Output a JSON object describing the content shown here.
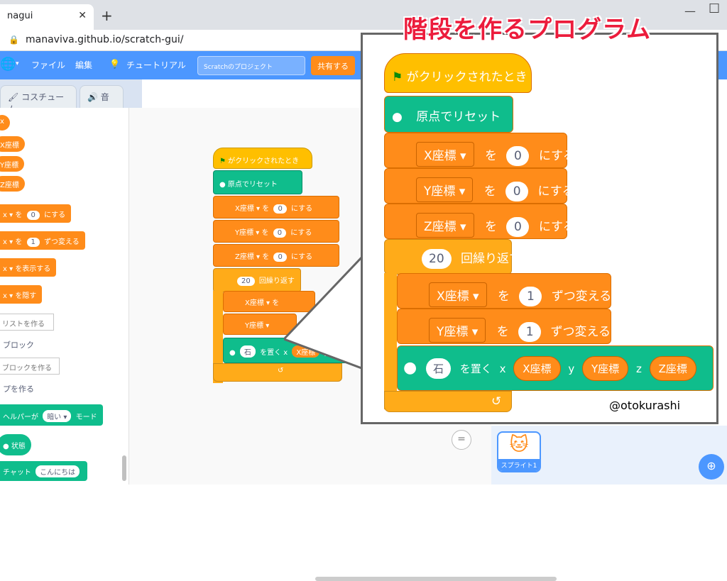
{
  "browser": {
    "tab_title": "nagui",
    "tab_close": "✕",
    "new_tab": "+",
    "minimize": "—",
    "maximize": "☐",
    "url": "manaviva.github.io/scratch-gui/"
  },
  "menubar": {
    "globe": "🌐",
    "globe_caret": "▾",
    "file": "ファイル",
    "edit": "編集",
    "tutorial_icon": "💡",
    "tutorial": "チュートリアル",
    "project_title": "Scratchのプロジェクト",
    "share": "共有する"
  },
  "tabs": {
    "costume": "コスチューム",
    "sound": "音"
  },
  "palette": {
    "reporters": [
      "x",
      "X座標",
      "Y座標",
      "Z座標"
    ],
    "set_block": {
      "var": "x ▾",
      "to": "を",
      "value": "0",
      "suffix": "にする"
    },
    "change_block": {
      "var": "x ▾",
      "to": "を",
      "value": "1",
      "suffix": "ずつ変える"
    },
    "show_block": {
      "var": "x ▾",
      "suffix": "を表示する"
    },
    "hide_block": {
      "var": "x ▾",
      "suffix": "を隠す"
    },
    "make_list": "リストを作る",
    "my_blocks": "ブロック",
    "make_block": "ブロックを作る",
    "section3": "プを作る",
    "helper_block": {
      "prefix": "ヘルパーが",
      "value": "暗い ▾",
      "suffix": "モード"
    },
    "state_block": "状態",
    "chat_block": {
      "prefix": "チャット",
      "value": "こんにちは"
    }
  },
  "code": {
    "hat": "がクリックされたとき",
    "reset": "原点でリセット",
    "set_x": {
      "var": "X座標 ▾",
      "to": "を",
      "value": "0",
      "suffix": "にする"
    },
    "set_y": {
      "var": "Y座標 ▾",
      "to": "を",
      "value": "0",
      "suffix": "にする"
    },
    "set_z": {
      "var": "Z座標 ▾",
      "to": "を",
      "value": "0",
      "suffix": "にする"
    },
    "repeat": {
      "value": "20",
      "label": "回繰り返す"
    },
    "change_x": {
      "var": "X座標 ▾",
      "to": "を",
      "value": "1",
      "suffix": "ずつ変える"
    },
    "change_y": {
      "var": "Y座標 ▾",
      "to": "を",
      "value": "1",
      "suffix": "ずつ変える"
    },
    "place": {
      "item": "石",
      "label": "を置く",
      "x_label": "x",
      "x": "X座標",
      "y_label": "y",
      "y": "Y座標",
      "z_label": "z",
      "z": "Z座標"
    },
    "loop_arrow": "↺"
  },
  "callout": {
    "title": "階段を作るプログラム",
    "credit": "@otokurashi"
  },
  "stage": {
    "zoom_reset": "=",
    "sprite_name": "スプライト1",
    "sprite_icon": "cat-icon",
    "extension_icon": "extension-icon"
  },
  "colors": {
    "motion_blue": "#4c97ff",
    "variables_orange": "#ff8c1a",
    "extension_green": "#0fbd8c",
    "events_yellow": "#ffbf00",
    "title_red": "#ec1c3c"
  }
}
